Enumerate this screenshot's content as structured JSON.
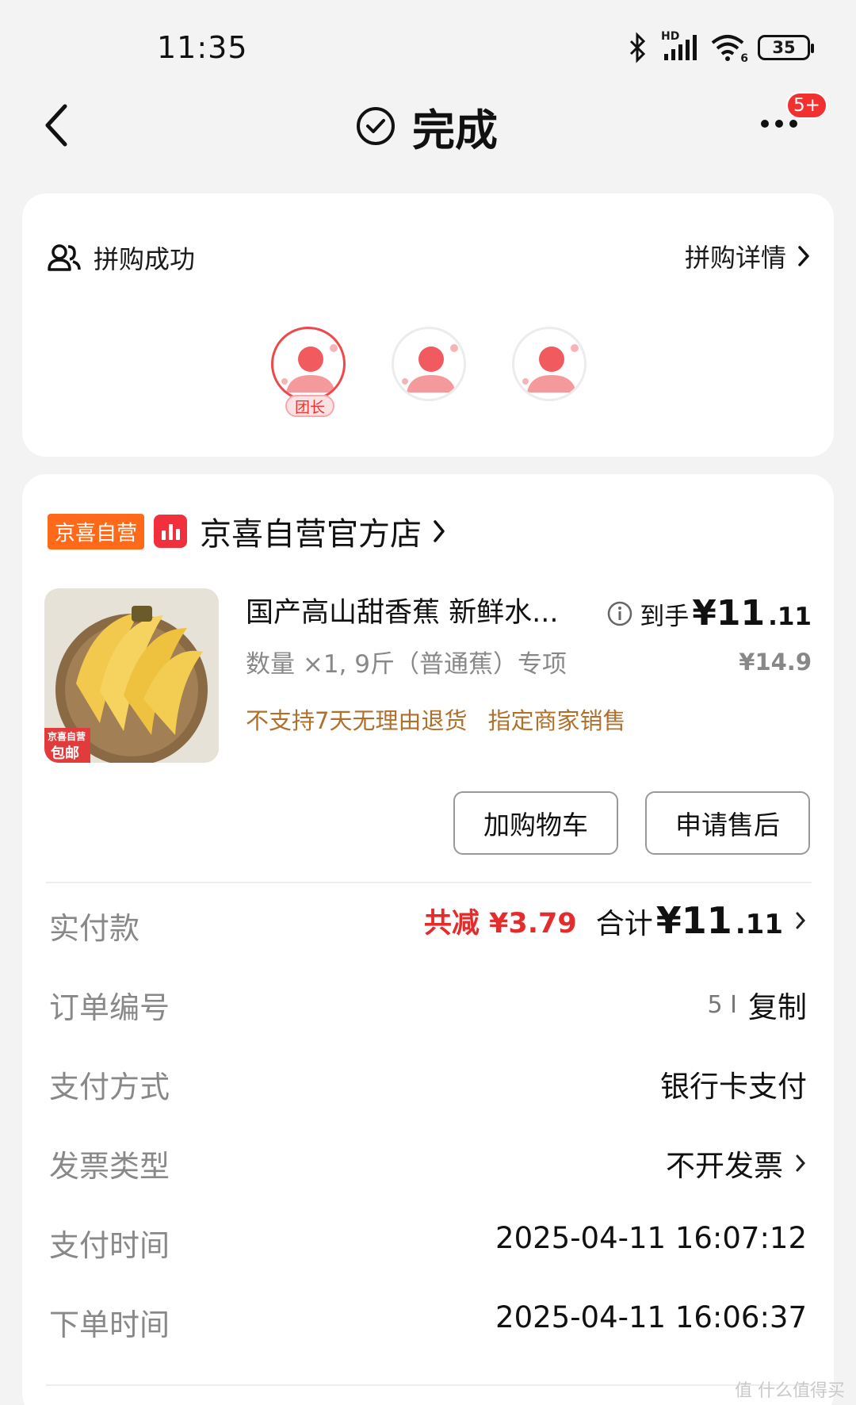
{
  "status_bar": {
    "time": "11:35",
    "network": "HD",
    "wifi_label": "6",
    "battery": "35"
  },
  "header": {
    "title": "完成",
    "more_badge": "5+"
  },
  "group_buy": {
    "title": "拼购成功",
    "detail_link": "拼购详情",
    "leader_tag": "团长"
  },
  "store": {
    "tag": "京喜自营",
    "name": "京喜自营官方店"
  },
  "product": {
    "title": "国产高山甜香蕉  新鲜水...",
    "spec": "数量 ×1, 9斤（普通蕉）专项",
    "tags": [
      "不支持7天无理由退货",
      "指定商家销售"
    ],
    "final_label": "到手",
    "final_price_int": "¥11",
    "final_price_dec": ".11",
    "original_price": "¥14.9",
    "image_badge_top": "京喜自营",
    "image_badge_bottom": "包邮"
  },
  "actions": {
    "add_cart": "加购物车",
    "after_sale": "申请售后"
  },
  "details": {
    "paid": {
      "label": "实付款",
      "saving": "共减 ¥3.79",
      "total_label": "合计",
      "total_int": "¥11",
      "total_dec": ".11"
    },
    "order_no": {
      "label": "订单编号",
      "value": "5 I",
      "copy": "复制"
    },
    "pay_method": {
      "label": "支付方式",
      "value": "银行卡支付"
    },
    "invoice": {
      "label": "发票类型",
      "value": "不开发票"
    },
    "pay_time": {
      "label": "支付时间",
      "value": "2025-04-11 16:07:12"
    },
    "order_time": {
      "label": "下单时间",
      "value": "2025-04-11 16:06:37"
    }
  },
  "watermark": "值 什么值得买",
  "colors": {
    "accent_red": "#f23030",
    "store_orange": "#ff6a1a",
    "tag_brown": "#b0702c"
  }
}
